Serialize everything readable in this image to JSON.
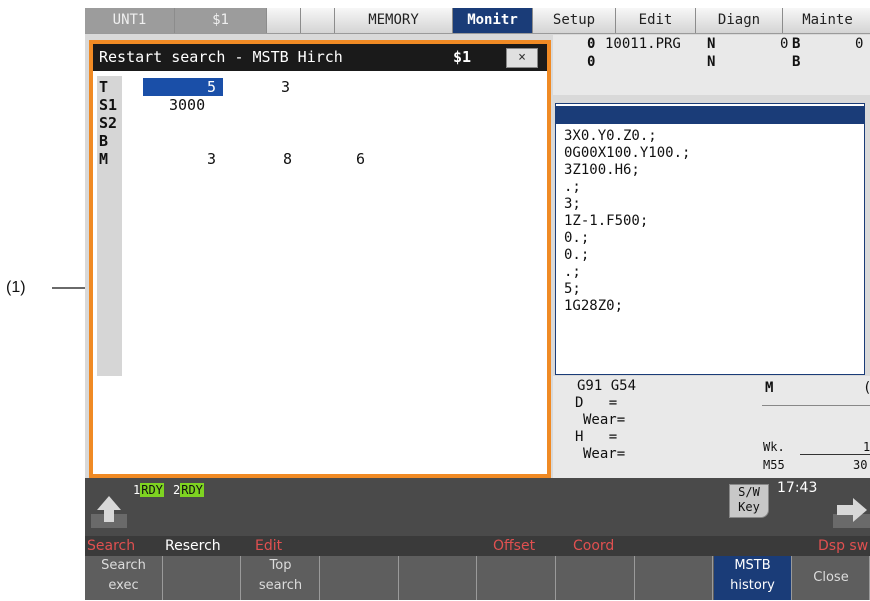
{
  "topbar": {
    "tabs": [
      {
        "label": "UNT1"
      },
      {
        "label": "$1"
      },
      {
        "label": ""
      },
      {
        "label": ""
      },
      {
        "label": "MEMORY"
      },
      {
        "label": "Monitr"
      },
      {
        "label": "Setup"
      },
      {
        "label": "Edit"
      },
      {
        "label": "Diagn"
      },
      {
        "label": "Mainte"
      }
    ]
  },
  "monitor": {
    "row1_a": "0",
    "row1_prog": "10011.PRG",
    "row1_n": "N",
    "row1_zero": "0",
    "row1_b": "B",
    "row1_cut": "0",
    "row2_a": "0",
    "row2_n": "N",
    "row2_b": "B",
    "program_lines": [
      "3X0.Y0.Z0.;",
      "0G00X100.Y100.;",
      "3Z100.H6;",
      ".;",
      "3;",
      "1Z-1.F500;",
      "0.;",
      "0.;",
      ".;",
      "5;",
      "1G28Z0;"
    ],
    "modal": "G91 G54",
    "d_line": "D   =",
    "wear1": "Wear=",
    "h_line": "H   =",
    "wear2": "Wear=",
    "m_label": "M",
    "m_cut": "(",
    "wk_label": "Wk.",
    "wk_value": "1",
    "m55_label": "M55",
    "m55_value": "30"
  },
  "popup": {
    "title": "Restart search - MSTB Hirch",
    "channel": "$1",
    "close_glyph": "×",
    "labels": [
      "T",
      "S1",
      "S2",
      "B",
      "M"
    ],
    "t_values": [
      "5",
      "3"
    ],
    "s1_value": "3000",
    "m_values": [
      "3",
      "8",
      "6"
    ]
  },
  "annotation": {
    "callout": "(1)"
  },
  "status": {
    "rdy1_num": "1",
    "rdy1": "RDY",
    "rdy2_num": "2",
    "rdy2": "RDY",
    "sw_key": "S/W\nKey",
    "time": "17:43"
  },
  "menu1": [
    "Search",
    "Reserch",
    "Edit",
    "Offset",
    "Coord",
    "Dsp sw"
  ],
  "menu2": [
    {
      "l1": "Search",
      "l2": "exec"
    },
    {
      "l1": "",
      "l2": ""
    },
    {
      "l1": "Top",
      "l2": "search"
    },
    {
      "l1": "",
      "l2": ""
    },
    {
      "l1": "",
      "l2": ""
    },
    {
      "l1": "",
      "l2": ""
    },
    {
      "l1": "",
      "l2": ""
    },
    {
      "l1": "",
      "l2": ""
    },
    {
      "l1": "MSTB",
      "l2": "history"
    },
    {
      "l1": "Close",
      "l2": ""
    }
  ],
  "colors": {
    "accent": "#1a3c78",
    "popup_border": "#f08a24",
    "rdy_green": "#7ed321",
    "menu_red": "#e05050"
  }
}
